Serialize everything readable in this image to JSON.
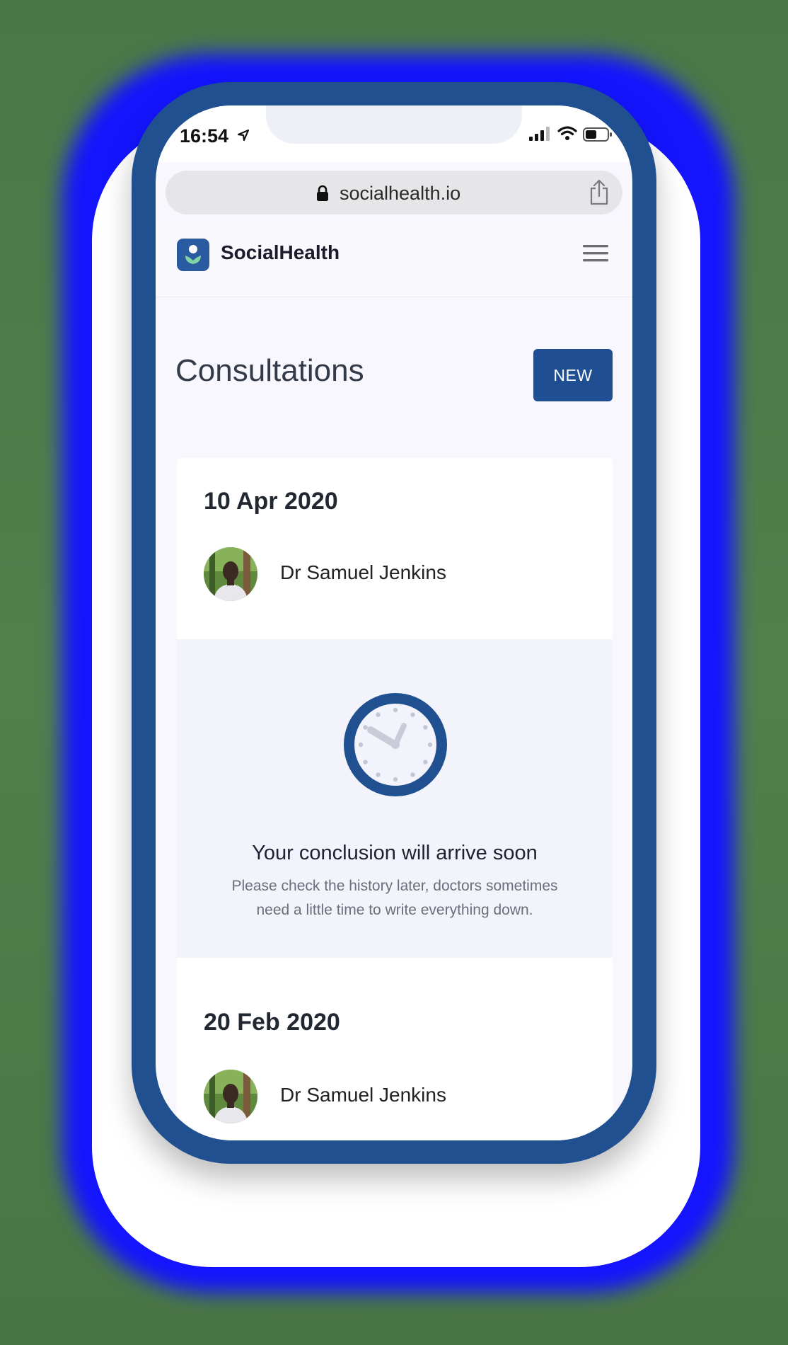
{
  "status_bar": {
    "time": "16:54"
  },
  "browser": {
    "url": "socialhealth.io"
  },
  "header": {
    "brand": "SocialHealth"
  },
  "page": {
    "title": "Consultations",
    "new_button": "NEW"
  },
  "consultations": [
    {
      "date": "10 Apr 2020",
      "doctor": "Dr Samuel Jenkins",
      "conclusion_title": "Your conclusion will arrive soon",
      "conclusion_text": "Please check the history later, doctors sometimes need a little time to write everything down."
    },
    {
      "date": "20 Feb 2020",
      "doctor": "Dr Samuel Jenkins"
    }
  ],
  "colors": {
    "brand_blue": "#20508f",
    "button_blue": "#1f4f92",
    "glow_blue": "#1414ff",
    "logo_green": "#7fd3a6"
  },
  "icons": [
    "location-arrow-icon",
    "signal-icon",
    "wifi-icon",
    "battery-icon",
    "lock-icon",
    "share-icon",
    "menu-icon",
    "clock-icon"
  ]
}
